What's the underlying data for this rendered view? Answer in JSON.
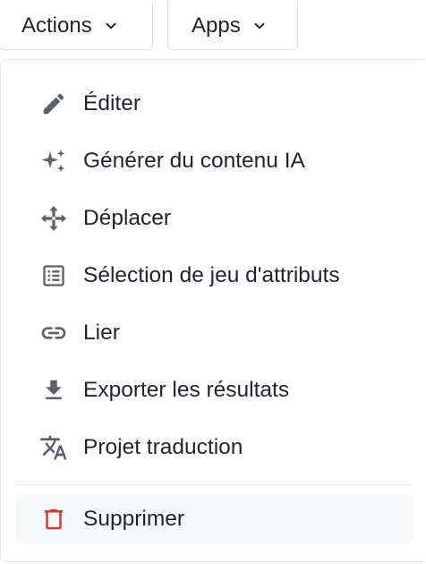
{
  "toolbar": {
    "actions_label": "Actions",
    "apps_label": "Apps"
  },
  "menu": {
    "items": [
      {
        "label": "Éditer",
        "icon": "pencil-icon"
      },
      {
        "label": "Générer du contenu IA",
        "icon": "sparkles-icon"
      },
      {
        "label": "Déplacer",
        "icon": "move-arrows-icon"
      },
      {
        "label": "Sélection de jeu d'attributs",
        "icon": "list-box-icon"
      },
      {
        "label": "Lier",
        "icon": "link-icon"
      },
      {
        "label": "Exporter les résultats",
        "icon": "download-icon"
      },
      {
        "label": "Projet traduction",
        "icon": "translate-icon"
      }
    ],
    "delete": {
      "label": "Supprimer",
      "icon": "trash-icon"
    }
  },
  "colors": {
    "text": "#1f2430",
    "icon": "#5b616b",
    "danger": "#d13b3b",
    "border": "#dcdfe4"
  }
}
